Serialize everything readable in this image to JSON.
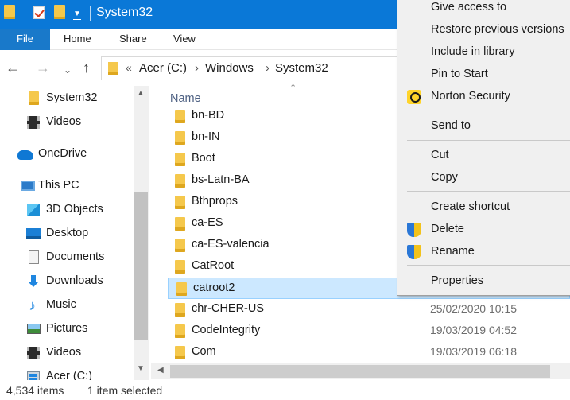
{
  "window": {
    "title": "System32",
    "accent_color": "#0a78d7"
  },
  "ribbon": {
    "tabs": [
      "File",
      "Home",
      "Share",
      "View"
    ]
  },
  "address": {
    "overflow": "«",
    "crumbs": [
      "Acer (C:)",
      "Windows",
      "System32"
    ],
    "separator": "›"
  },
  "nav_pane": {
    "items": [
      {
        "label": "System32",
        "icon": "folder-icon"
      },
      {
        "label": "Videos",
        "icon": "video-icon"
      },
      {
        "label": "OneDrive",
        "icon": "cloud-icon"
      },
      {
        "label": "This PC",
        "icon": "computer-icon"
      },
      {
        "label": "3D Objects",
        "icon": "3d-objects-icon"
      },
      {
        "label": "Desktop",
        "icon": "desktop-icon"
      },
      {
        "label": "Documents",
        "icon": "documents-icon"
      },
      {
        "label": "Downloads",
        "icon": "download-icon"
      },
      {
        "label": "Music",
        "icon": "music-icon"
      },
      {
        "label": "Pictures",
        "icon": "pictures-icon"
      },
      {
        "label": "Videos",
        "icon": "video-icon"
      },
      {
        "label": "Acer (C:)",
        "icon": "drive-icon"
      }
    ]
  },
  "file_list": {
    "column_name": "Name",
    "rows": [
      {
        "name": "bn-BD",
        "date": ""
      },
      {
        "name": "bn-IN",
        "date": ""
      },
      {
        "name": "Boot",
        "date": ""
      },
      {
        "name": "bs-Latn-BA",
        "date": ""
      },
      {
        "name": "Bthprops",
        "date": ""
      },
      {
        "name": "ca-ES",
        "date": ""
      },
      {
        "name": "ca-ES-valencia",
        "date": ""
      },
      {
        "name": "CatRoot",
        "date": ""
      },
      {
        "name": "catroot2",
        "date": "",
        "selected": true
      },
      {
        "name": "chr-CHER-US",
        "date": "25/02/2020 10:15"
      },
      {
        "name": "CodeIntegrity",
        "date": "19/03/2019 04:52"
      },
      {
        "name": "Com",
        "date": "19/03/2019 06:18"
      }
    ]
  },
  "status_bar": {
    "item_count": "4,534 items",
    "selection": "1 item selected"
  },
  "context_menu": {
    "items": [
      {
        "label": "Give access to"
      },
      {
        "label": "Restore previous versions"
      },
      {
        "label": "Include in library"
      },
      {
        "label": "Pin to Start"
      },
      {
        "label": "Norton Security",
        "icon": "norton-icon"
      },
      {
        "label": "Send to"
      },
      {
        "label": "Cut"
      },
      {
        "label": "Copy"
      },
      {
        "label": "Create shortcut"
      },
      {
        "label": "Delete",
        "icon": "uac-shield-icon"
      },
      {
        "label": "Rename",
        "icon": "uac-shield-icon"
      },
      {
        "label": "Properties"
      }
    ]
  }
}
